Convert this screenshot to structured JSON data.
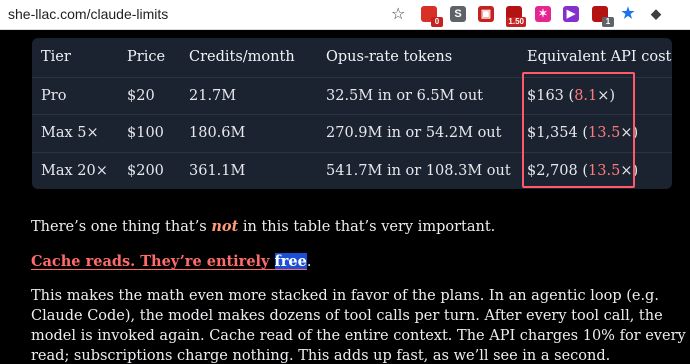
{
  "browser": {
    "url": "she-llac.com/claude-limits",
    "bookmark_icon": "star-icon",
    "extensions": [
      {
        "name": "ext-red-icon",
        "color": "#d93025",
        "badge": "0"
      },
      {
        "name": "ext-s-icon",
        "color": "#5f6368",
        "label": "S"
      },
      {
        "name": "ext-gift-icon",
        "color": "#c5221f"
      },
      {
        "name": "ext-red-badge-icon",
        "color": "#b31412",
        "badge": "1.50"
      },
      {
        "name": "ext-pink-icon",
        "color": "#e52592"
      },
      {
        "name": "ext-play-icon",
        "color": "#8430ce"
      },
      {
        "name": "ext-shield-icon",
        "color": "#b31412",
        "badge": "1"
      },
      {
        "name": "ext-blue-star-icon",
        "color": "#1a73e8"
      },
      {
        "name": "ext-dark-icon",
        "color": "#3c4043"
      }
    ]
  },
  "table": {
    "headers": [
      "Tier",
      "Price",
      "Credits/month",
      "Opus-rate tokens",
      "Equivalent API cost"
    ],
    "rows": [
      {
        "tier": "Pro",
        "price": "$20",
        "credits": "21.7M",
        "tokens": "32.5M in or 6.5M out",
        "cost": "$163",
        "mult": "8.1"
      },
      {
        "tier": "Max 5×",
        "price": "$100",
        "credits": "180.6M",
        "tokens": "270.9M in or 54.2M out",
        "cost": "$1,354",
        "mult": "13.5"
      },
      {
        "tier": "Max 20×",
        "price": "$200",
        "credits": "361.1M",
        "tokens": "541.7M in or 108.3M out",
        "cost": "$2,708",
        "mult": "13.5"
      }
    ]
  },
  "article": {
    "p1_before": "There’s one thing that’s ",
    "p1_em": "not",
    "p1_after": " in this table that’s very important.",
    "heading_link": "Cache reads. They’re entirely ",
    "heading_selected": "free",
    "heading_period": ".",
    "body": "This makes the math even more stacked in favor of the plans. In an agentic loop (e.g. Claude Code), the model makes dozens of tool calls per turn. After every tool call, the model is invoked again. Cache read of the entire context. The API charges 10% for every read; subscriptions charge nothing. This adds up fast, as we’ll see in a second."
  },
  "colors": {
    "accent_red": "#ff5a6b",
    "multiplier": "#ff7b7b",
    "selection": "#1a4fd6"
  }
}
